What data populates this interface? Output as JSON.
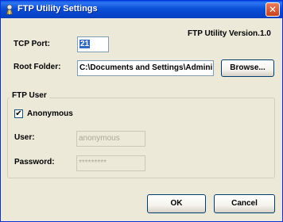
{
  "window": {
    "title": "FTP Utility Settings",
    "close_glyph": "✕",
    "version_label": "FTP Utility Version.1.0"
  },
  "tcp": {
    "label": "TCP Port:",
    "value": "21"
  },
  "root": {
    "label": "Root Folder:",
    "value": "C:\\Documents and Settings\\Admini",
    "browse_label": "Browse..."
  },
  "ftp_user": {
    "group_label": "FTP User",
    "anonymous_label": "Anonymous",
    "anonymous_checked": true,
    "check_glyph": "✔",
    "user_label": "User:",
    "user_value": "anonymous",
    "password_label": "Password:",
    "password_value": "*********"
  },
  "buttons": {
    "ok": "OK",
    "cancel": "Cancel"
  },
  "icons": {
    "title_icon": "ftp-utility-icon"
  },
  "colors": {
    "titlebar": "#0a4fd6",
    "dialog_bg": "#ece9d8",
    "selection": "#316ac5"
  }
}
